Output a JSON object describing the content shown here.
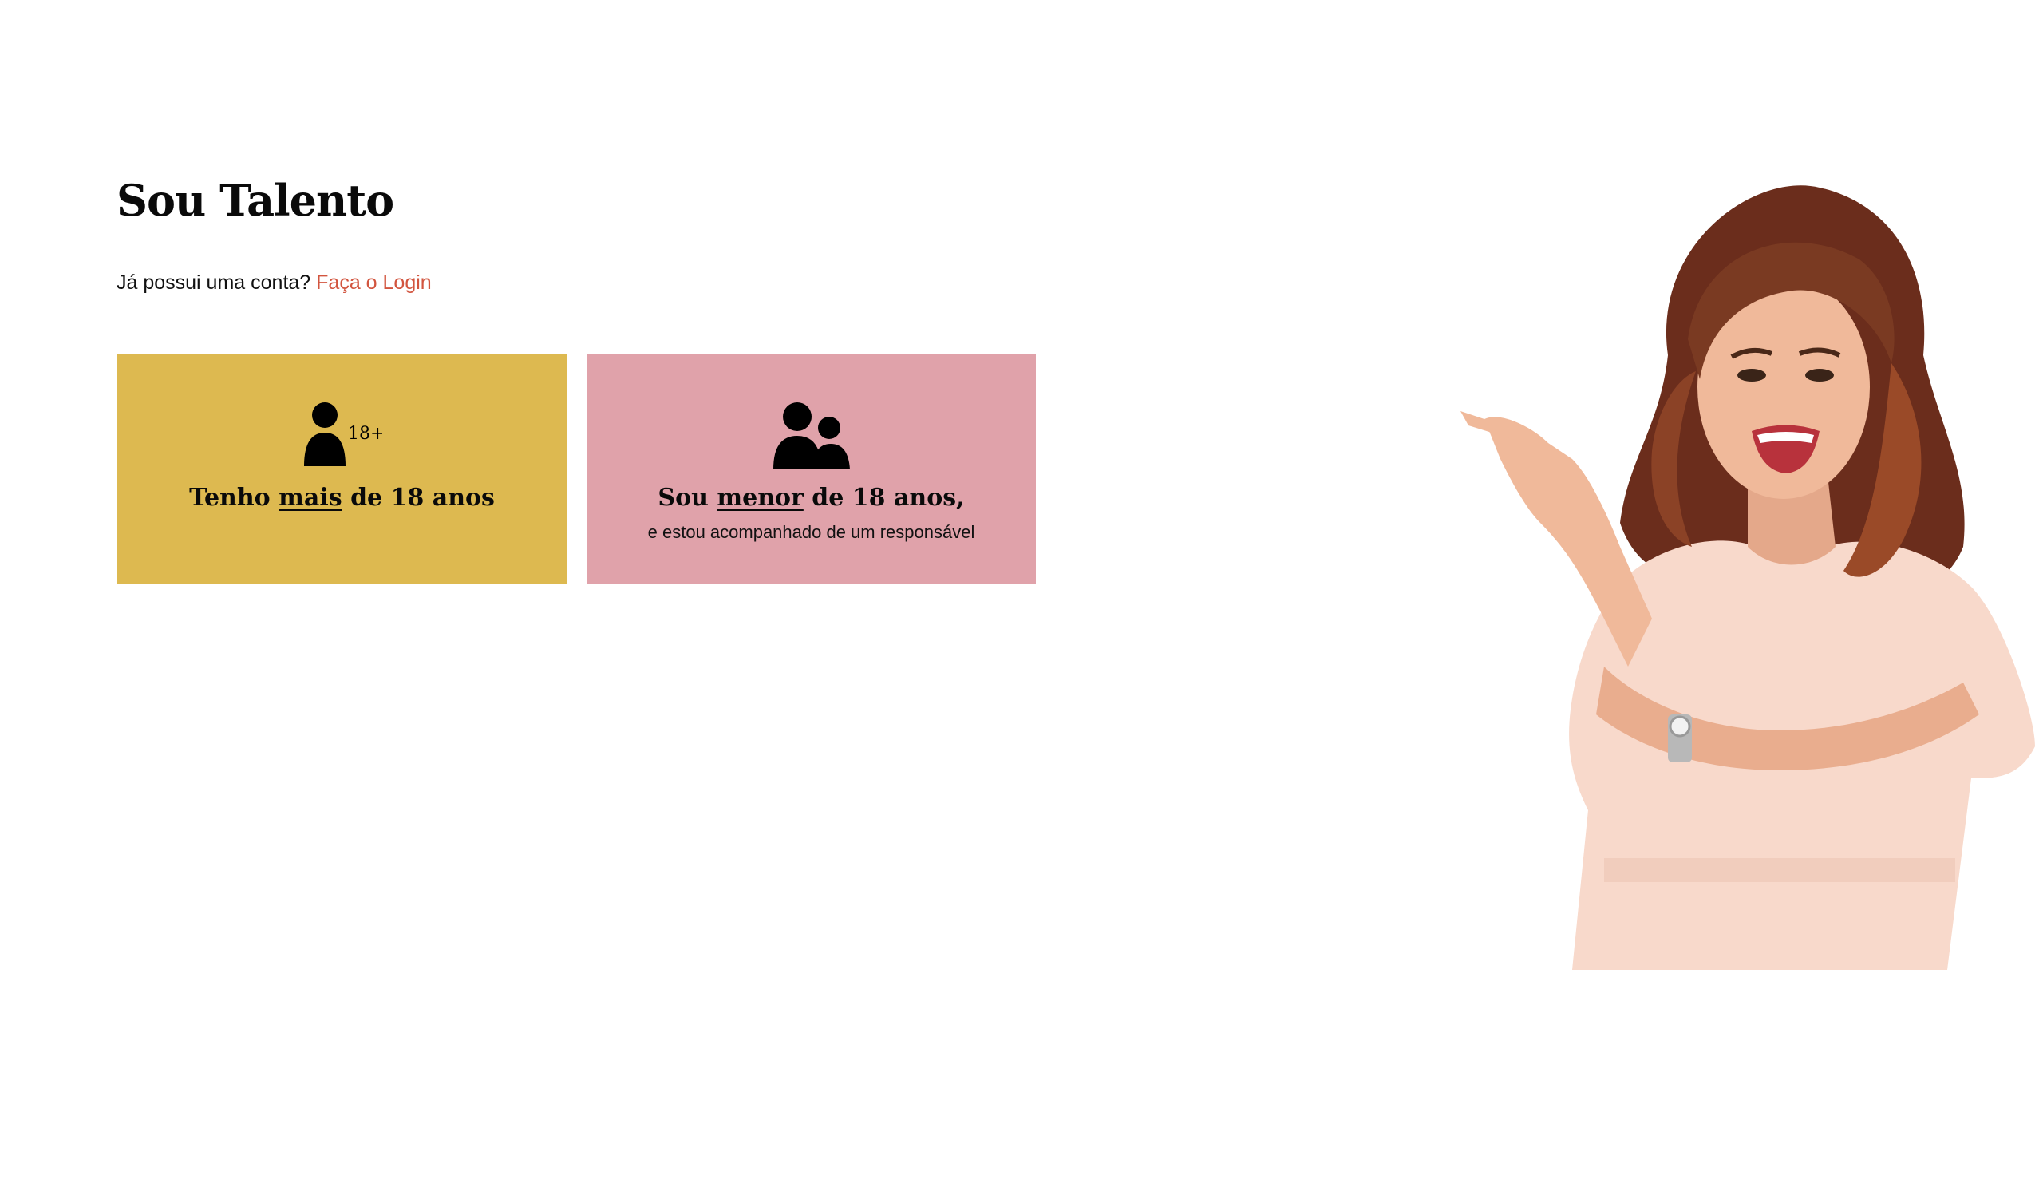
{
  "page": {
    "title": "Sou Talento",
    "login_prompt": "Já possui uma conta?",
    "login_link": "Faça o Login"
  },
  "options": [
    {
      "icon": "person-18plus-icon",
      "icon_badge": "18+",
      "title_prefix": "Tenho",
      "title_emphasis": "mais",
      "title_suffix": "de 18 anos",
      "background": "#ddb950"
    },
    {
      "icon": "adult-with-child-icon",
      "title_prefix": "Sou",
      "title_emphasis": "menor",
      "title_suffix": "de 18 anos,",
      "subtitle": "e estou acompanhado de um responsável",
      "background": "#e0a2aa"
    }
  ],
  "colors": {
    "accent_link": "#d2553f",
    "card_adult": "#ddb950",
    "card_minor": "#e0a2aa"
  },
  "hero": {
    "image": "smiling-woman-pointing-photo"
  }
}
